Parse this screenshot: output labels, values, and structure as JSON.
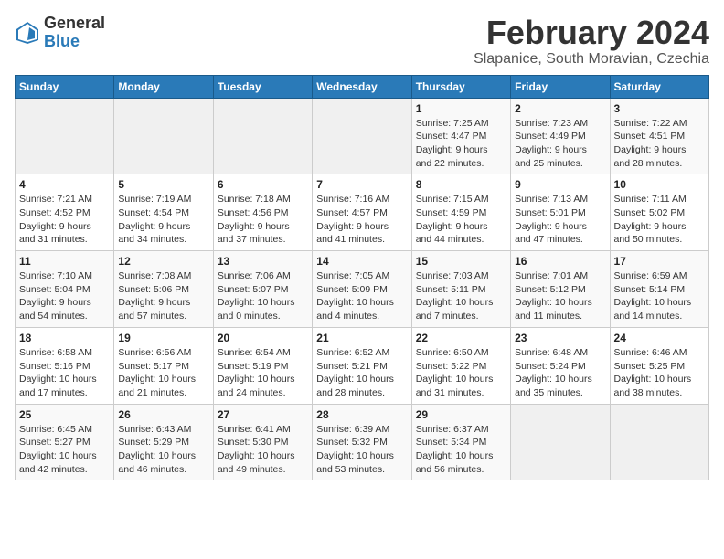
{
  "header": {
    "logo_line1": "General",
    "logo_line2": "Blue",
    "month_year": "February 2024",
    "location": "Slapanice, South Moravian, Czechia"
  },
  "days_of_week": [
    "Sunday",
    "Monday",
    "Tuesday",
    "Wednesday",
    "Thursday",
    "Friday",
    "Saturday"
  ],
  "weeks": [
    [
      {
        "day": "",
        "info": ""
      },
      {
        "day": "",
        "info": ""
      },
      {
        "day": "",
        "info": ""
      },
      {
        "day": "",
        "info": ""
      },
      {
        "day": "1",
        "info": "Sunrise: 7:25 AM\nSunset: 4:47 PM\nDaylight: 9 hours\nand 22 minutes."
      },
      {
        "day": "2",
        "info": "Sunrise: 7:23 AM\nSunset: 4:49 PM\nDaylight: 9 hours\nand 25 minutes."
      },
      {
        "day": "3",
        "info": "Sunrise: 7:22 AM\nSunset: 4:51 PM\nDaylight: 9 hours\nand 28 minutes."
      }
    ],
    [
      {
        "day": "4",
        "info": "Sunrise: 7:21 AM\nSunset: 4:52 PM\nDaylight: 9 hours\nand 31 minutes."
      },
      {
        "day": "5",
        "info": "Sunrise: 7:19 AM\nSunset: 4:54 PM\nDaylight: 9 hours\nand 34 minutes."
      },
      {
        "day": "6",
        "info": "Sunrise: 7:18 AM\nSunset: 4:56 PM\nDaylight: 9 hours\nand 37 minutes."
      },
      {
        "day": "7",
        "info": "Sunrise: 7:16 AM\nSunset: 4:57 PM\nDaylight: 9 hours\nand 41 minutes."
      },
      {
        "day": "8",
        "info": "Sunrise: 7:15 AM\nSunset: 4:59 PM\nDaylight: 9 hours\nand 44 minutes."
      },
      {
        "day": "9",
        "info": "Sunrise: 7:13 AM\nSunset: 5:01 PM\nDaylight: 9 hours\nand 47 minutes."
      },
      {
        "day": "10",
        "info": "Sunrise: 7:11 AM\nSunset: 5:02 PM\nDaylight: 9 hours\nand 50 minutes."
      }
    ],
    [
      {
        "day": "11",
        "info": "Sunrise: 7:10 AM\nSunset: 5:04 PM\nDaylight: 9 hours\nand 54 minutes."
      },
      {
        "day": "12",
        "info": "Sunrise: 7:08 AM\nSunset: 5:06 PM\nDaylight: 9 hours\nand 57 minutes."
      },
      {
        "day": "13",
        "info": "Sunrise: 7:06 AM\nSunset: 5:07 PM\nDaylight: 10 hours\nand 0 minutes."
      },
      {
        "day": "14",
        "info": "Sunrise: 7:05 AM\nSunset: 5:09 PM\nDaylight: 10 hours\nand 4 minutes."
      },
      {
        "day": "15",
        "info": "Sunrise: 7:03 AM\nSunset: 5:11 PM\nDaylight: 10 hours\nand 7 minutes."
      },
      {
        "day": "16",
        "info": "Sunrise: 7:01 AM\nSunset: 5:12 PM\nDaylight: 10 hours\nand 11 minutes."
      },
      {
        "day": "17",
        "info": "Sunrise: 6:59 AM\nSunset: 5:14 PM\nDaylight: 10 hours\nand 14 minutes."
      }
    ],
    [
      {
        "day": "18",
        "info": "Sunrise: 6:58 AM\nSunset: 5:16 PM\nDaylight: 10 hours\nand 17 minutes."
      },
      {
        "day": "19",
        "info": "Sunrise: 6:56 AM\nSunset: 5:17 PM\nDaylight: 10 hours\nand 21 minutes."
      },
      {
        "day": "20",
        "info": "Sunrise: 6:54 AM\nSunset: 5:19 PM\nDaylight: 10 hours\nand 24 minutes."
      },
      {
        "day": "21",
        "info": "Sunrise: 6:52 AM\nSunset: 5:21 PM\nDaylight: 10 hours\nand 28 minutes."
      },
      {
        "day": "22",
        "info": "Sunrise: 6:50 AM\nSunset: 5:22 PM\nDaylight: 10 hours\nand 31 minutes."
      },
      {
        "day": "23",
        "info": "Sunrise: 6:48 AM\nSunset: 5:24 PM\nDaylight: 10 hours\nand 35 minutes."
      },
      {
        "day": "24",
        "info": "Sunrise: 6:46 AM\nSunset: 5:25 PM\nDaylight: 10 hours\nand 38 minutes."
      }
    ],
    [
      {
        "day": "25",
        "info": "Sunrise: 6:45 AM\nSunset: 5:27 PM\nDaylight: 10 hours\nand 42 minutes."
      },
      {
        "day": "26",
        "info": "Sunrise: 6:43 AM\nSunset: 5:29 PM\nDaylight: 10 hours\nand 46 minutes."
      },
      {
        "day": "27",
        "info": "Sunrise: 6:41 AM\nSunset: 5:30 PM\nDaylight: 10 hours\nand 49 minutes."
      },
      {
        "day": "28",
        "info": "Sunrise: 6:39 AM\nSunset: 5:32 PM\nDaylight: 10 hours\nand 53 minutes."
      },
      {
        "day": "29",
        "info": "Sunrise: 6:37 AM\nSunset: 5:34 PM\nDaylight: 10 hours\nand 56 minutes."
      },
      {
        "day": "",
        "info": ""
      },
      {
        "day": "",
        "info": ""
      }
    ]
  ]
}
